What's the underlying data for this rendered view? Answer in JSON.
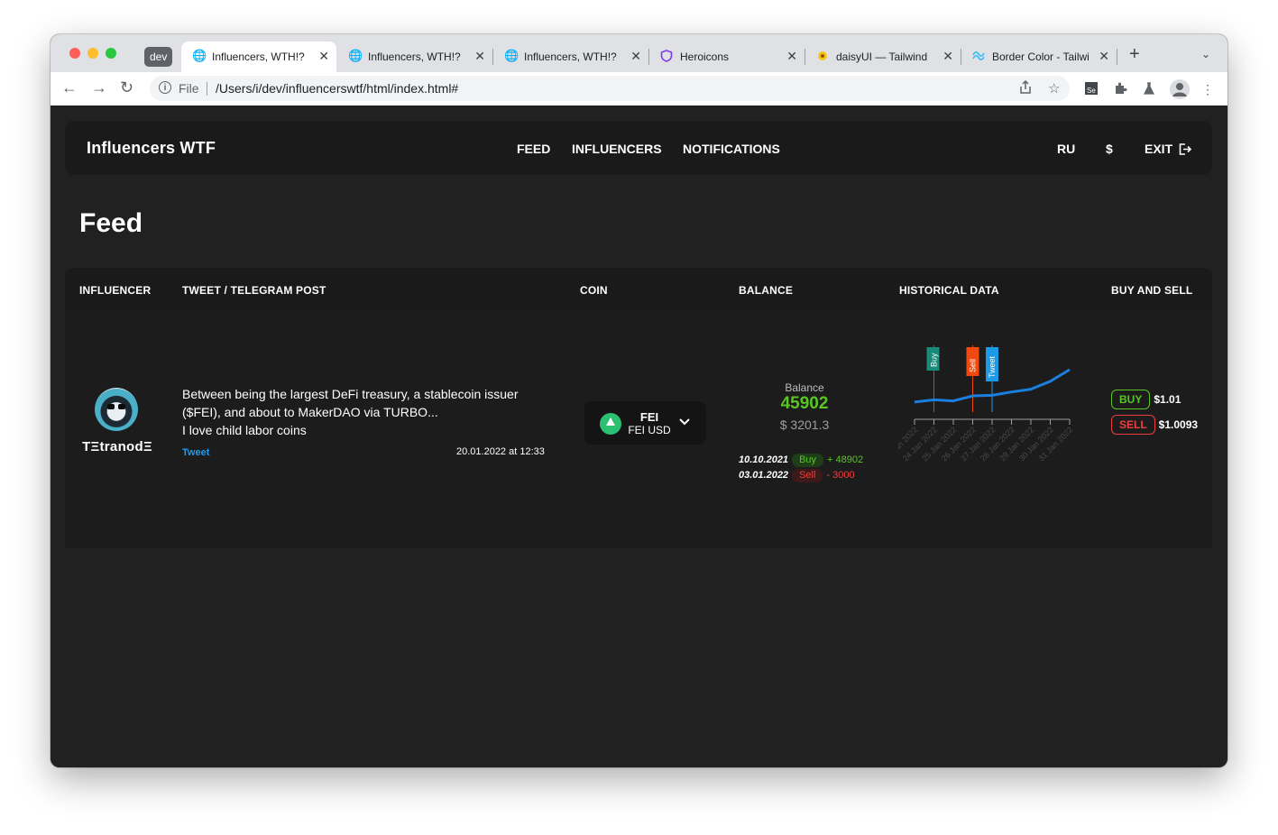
{
  "browser": {
    "profile_badge": "dev",
    "tabs": [
      {
        "title": "Influencers, WTH!?",
        "icon": "globe-icon",
        "active": true
      },
      {
        "title": "Influencers, WTH!?",
        "icon": "globe-icon",
        "active": false
      },
      {
        "title": "Influencers, WTH!?",
        "icon": "globe-icon",
        "active": false
      },
      {
        "title": "Heroicons",
        "icon": "heroicons-shield-icon",
        "active": false
      },
      {
        "title": "daisyUI — Tailwind",
        "icon": "daisyui-flower-icon",
        "active": false
      },
      {
        "title": "Border Color - Tailwind",
        "icon": "tailwind-wave-icon",
        "active": false
      }
    ],
    "address": {
      "scheme_label": "File",
      "url": "/Users/i/dev/influencerswtf/html/index.html#"
    }
  },
  "app": {
    "brand": "Influencers WTF",
    "nav": [
      "FEED",
      "INFLUENCERS",
      "NOTIFICATIONS"
    ],
    "lang": "RU",
    "currency": "$",
    "exit": "EXIT"
  },
  "page": {
    "title": "Feed"
  },
  "table": {
    "headers": [
      "INFLUENCER",
      "TWEET / TELEGRAM POST",
      "COIN",
      "BALANCE",
      "HISTORICAL DATA",
      "BUY AND SELL"
    ],
    "rows": [
      {
        "influencer": "TΞtranodΞ",
        "post_text": "Between being the largest DeFi treasury, a stablecoin issuer ($FEI), and about to MakerDAO via TURBO...\nI love child labor coins",
        "post_link": "Tweet",
        "post_date": "20.01.2022 at 12:33",
        "coin": {
          "symbol": "FEI",
          "name": "FEI USD"
        },
        "balance": {
          "label": "Balance",
          "value": "45902",
          "usd": "$ 3201.3",
          "transactions": [
            {
              "date": "10.10.2021",
              "type": "Buy",
              "amount": "+ 48902"
            },
            {
              "date": "03.01.2022",
              "type": "Sell",
              "amount": "- 3000"
            }
          ]
        },
        "trade": {
          "buy_label": "BUY",
          "buy_price": "$1.01",
          "sell_label": "SELL",
          "sell_price": "$1.0093"
        }
      }
    ]
  },
  "chart_data": {
    "type": "line",
    "x": [
      "23 Jan 2022",
      "24 Jan 2022",
      "25 Jan 2022",
      "26 Jan 2022",
      "27 Jan 2022",
      "28 Jan 2022",
      "29 Jan 2022",
      "30 Jan 2022",
      "31 Jan 2022"
    ],
    "series": [
      {
        "values": [
          1.8,
          2.2,
          2.0,
          2.9,
          3.0,
          3.6,
          4.1,
          5.5,
          7.6
        ],
        "color": "#1b7fe0"
      }
    ],
    "ylim": [
      0,
      10
    ],
    "markers": [
      {
        "label": "Buy",
        "x_index": 1,
        "color": "#1a8a7a"
      },
      {
        "label": "Sell",
        "x_index": 3,
        "color": "#f04a10"
      },
      {
        "label": "Tweet",
        "x_index": 4,
        "color": "#1b9ae8"
      }
    ],
    "grid": false
  }
}
